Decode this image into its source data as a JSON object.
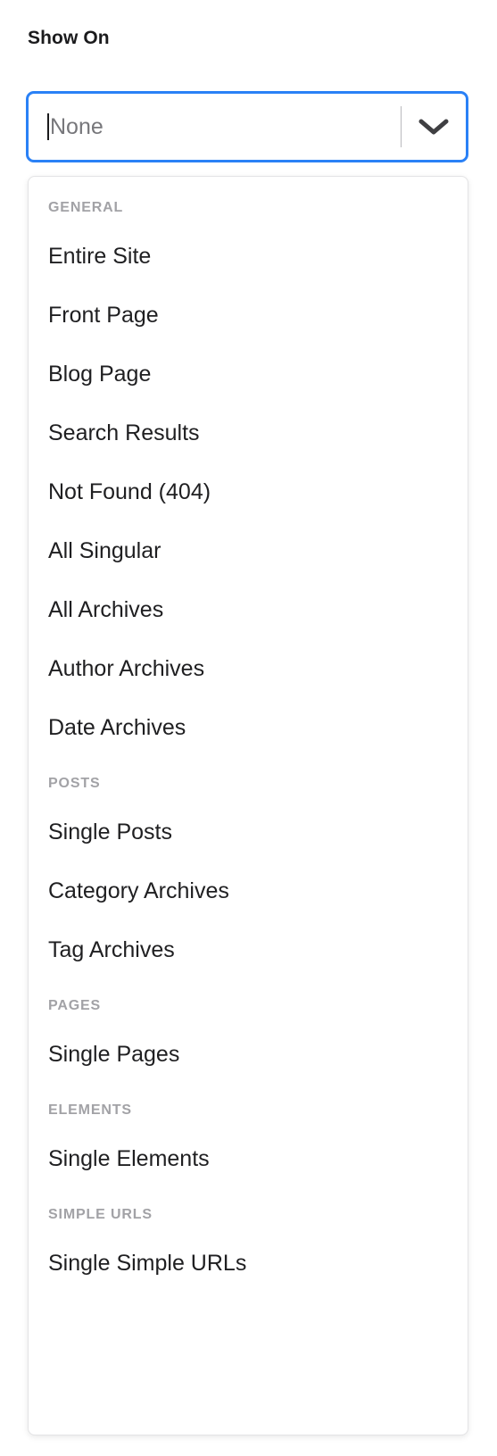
{
  "field": {
    "label": "Show On",
    "placeholder": "None",
    "value": "",
    "caret_visible": true,
    "focused": true,
    "accent_color": "#2a81f6",
    "arrow_icon": "chevron-down-icon"
  },
  "dropdown": {
    "open": true,
    "groups": [
      {
        "header": "GENERAL",
        "options": [
          {
            "label": "Entire Site"
          },
          {
            "label": "Front Page"
          },
          {
            "label": "Blog Page"
          },
          {
            "label": "Search Results"
          },
          {
            "label": "Not Found (404)"
          },
          {
            "label": "All Singular"
          },
          {
            "label": "All Archives"
          },
          {
            "label": "Author Archives"
          },
          {
            "label": "Date Archives"
          }
        ]
      },
      {
        "header": "POSTS",
        "options": [
          {
            "label": "Single Posts"
          },
          {
            "label": "Category Archives"
          },
          {
            "label": "Tag Archives"
          }
        ]
      },
      {
        "header": "PAGES",
        "options": [
          {
            "label": "Single Pages"
          }
        ]
      },
      {
        "header": "ELEMENTS",
        "options": [
          {
            "label": "Single Elements"
          }
        ]
      },
      {
        "header": "SIMPLE URLS",
        "options": [
          {
            "label": "Single Simple URLs"
          }
        ]
      }
    ]
  },
  "colors": {
    "accent": "#2a81f6",
    "option_text": "#1f1f21",
    "group_header_text": "#a2a2a6",
    "placeholder_text": "#77777b",
    "panel_border": "#e3e3e5",
    "label_text": "#1b1b1d"
  }
}
